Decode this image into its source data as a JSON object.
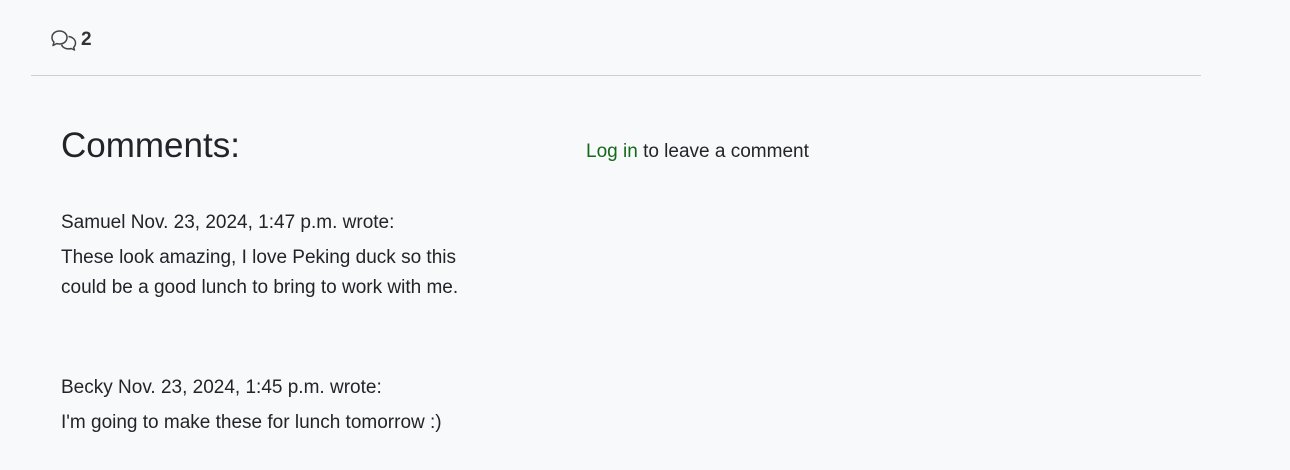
{
  "post_stats": {
    "comment_count": "2"
  },
  "comments_section": {
    "heading": "Comments:",
    "comments": [
      {
        "author": "Samuel",
        "date": "Nov. 23, 2024, 1:47 p.m.",
        "wrote_label": "wrote:",
        "body": "These look amazing, I love Peking duck so this could be a good lunch to bring to work with me."
      },
      {
        "author": "Becky",
        "date": "Nov. 23, 2024, 1:45 p.m.",
        "wrote_label": "wrote:",
        "body": "I'm going to make these for lunch tomorrow :)"
      }
    ]
  },
  "login_prompt": {
    "link_text": "Log in",
    "suffix": "to leave a comment"
  },
  "colors": {
    "background": "#f8f9fb",
    "text": "#212529",
    "link": "#16681a",
    "divider": "#cfcfcf"
  },
  "icons": {
    "comment_count_icon": "chat-bubbles-icon"
  }
}
